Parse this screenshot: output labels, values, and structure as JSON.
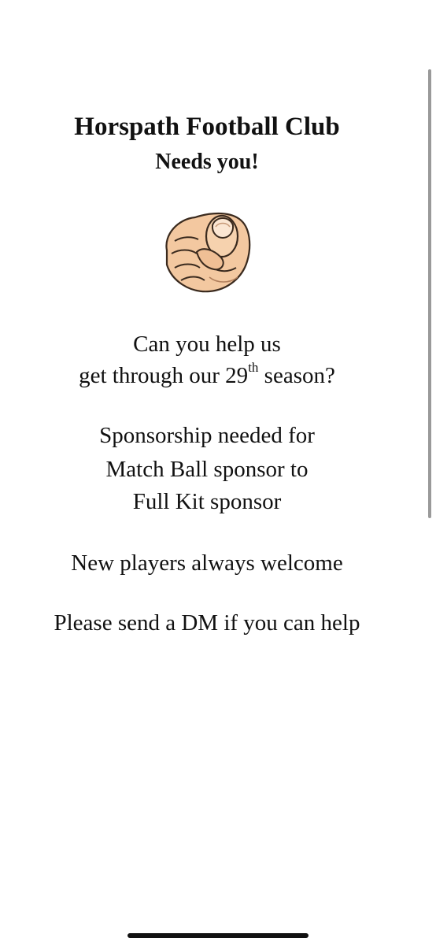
{
  "poster": {
    "title": "Horspath Football Club",
    "subtitle": "Needs you!",
    "hand_icon": "pointing-finger-icon",
    "question_line1": "Can you help us",
    "question_line2_pre": "get through our 29",
    "question_line2_sup": "th",
    "question_line2_post": " season?",
    "sponsor_line1": "Sponsorship needed for",
    "sponsor_line2": "Match Ball sponsor to",
    "sponsor_line3": "Full Kit sponsor",
    "players_line": "New players always welcome",
    "dm_line": "Please send a DM if you can help"
  }
}
